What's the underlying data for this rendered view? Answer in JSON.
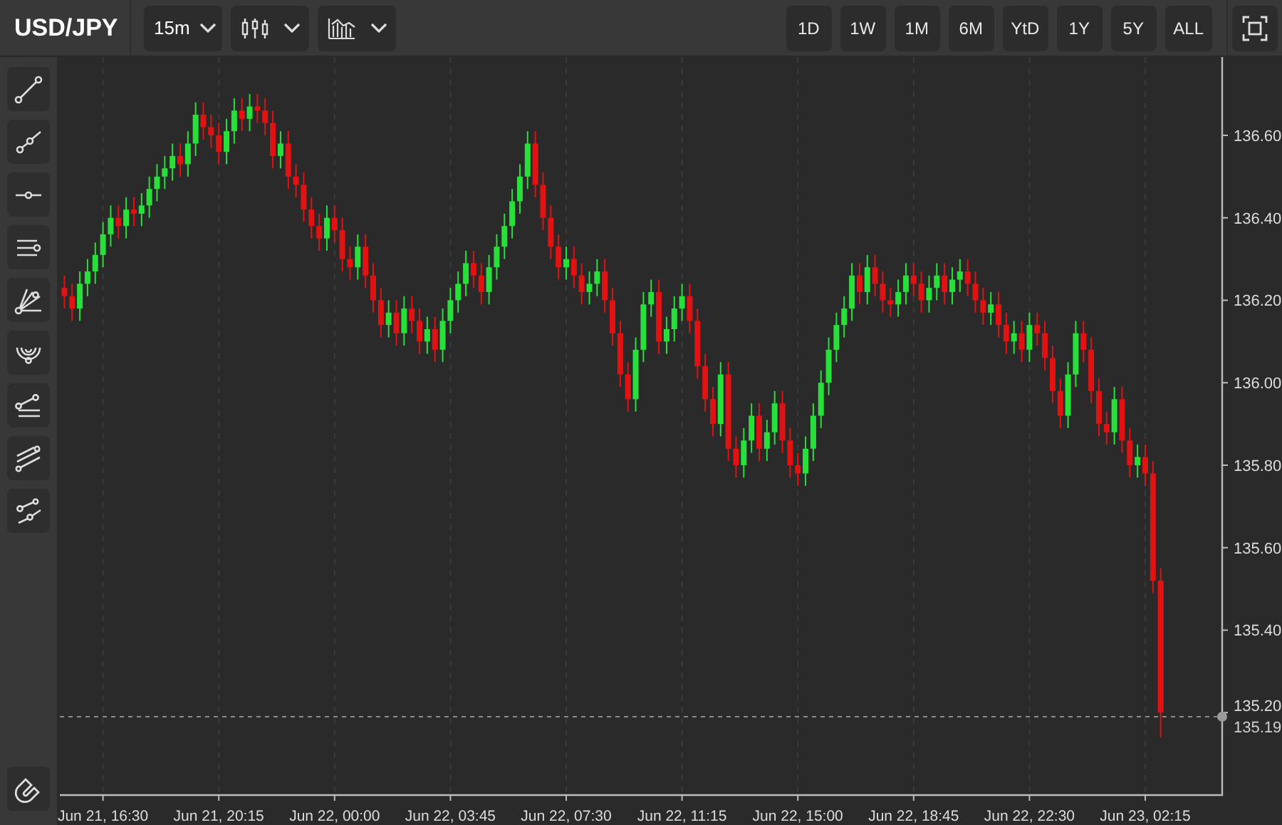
{
  "toolbar": {
    "symbol": "USD/JPY",
    "interval": "15m",
    "ranges": [
      {
        "label": "1D",
        "selected": false
      },
      {
        "label": "1W",
        "selected": false
      },
      {
        "label": "1M",
        "selected": false
      },
      {
        "label": "6M",
        "selected": false
      },
      {
        "label": "YtD",
        "selected": false
      },
      {
        "label": "1Y",
        "selected": false
      },
      {
        "label": "5Y",
        "selected": false
      },
      {
        "label": "ALL",
        "selected": false
      }
    ]
  },
  "chart": {
    "chart_data": {
      "type": "candlestick",
      "ylim": [
        135.0,
        136.79
      ],
      "ref_lines": [
        {
          "axis": "y",
          "value": 135.19,
          "label": "135.19"
        }
      ],
      "yticks": [
        {
          "value": 136.6,
          "label": "136.60"
        },
        {
          "value": 136.4,
          "label": "136.40"
        },
        {
          "value": 136.2,
          "label": "136.20"
        },
        {
          "value": 136.0,
          "label": "136.00"
        },
        {
          "value": 135.8,
          "label": "135.80"
        },
        {
          "value": 135.6,
          "label": "135.60"
        },
        {
          "value": 135.4,
          "label": "135.40"
        },
        {
          "value": 135.2,
          "label": "135.20"
        }
      ],
      "categories": [
        null,
        null,
        null,
        null,
        null,
        "Jun 21, 16:30",
        null,
        null,
        null,
        null,
        null,
        null,
        null,
        null,
        null,
        null,
        null,
        null,
        null,
        null,
        "Jun 21, 20:15",
        null,
        null,
        null,
        null,
        null,
        null,
        null,
        null,
        null,
        null,
        null,
        null,
        null,
        null,
        "Jun 22, 00:00",
        null,
        null,
        null,
        null,
        null,
        null,
        null,
        null,
        null,
        null,
        null,
        null,
        null,
        null,
        "Jun 22, 03:45",
        null,
        null,
        null,
        null,
        null,
        null,
        null,
        null,
        null,
        null,
        null,
        null,
        null,
        null,
        "Jun 22, 07:30",
        null,
        null,
        null,
        null,
        null,
        null,
        null,
        null,
        null,
        null,
        null,
        null,
        null,
        null,
        "Jun 22, 11:15",
        null,
        null,
        null,
        null,
        null,
        null,
        null,
        null,
        null,
        null,
        null,
        null,
        null,
        null,
        "Jun 22, 15:00",
        null,
        null,
        null,
        null,
        null,
        null,
        null,
        null,
        null,
        null,
        null,
        null,
        null,
        null,
        "Jun 22, 18:45",
        null,
        null,
        null,
        null,
        null,
        null,
        null,
        null,
        null,
        null,
        null,
        null,
        null,
        null,
        "Jun 22, 22:30",
        null,
        null,
        null,
        null,
        null,
        null,
        null,
        null,
        null,
        null,
        null,
        null,
        null,
        null,
        "Jun 23, 02:15",
        null,
        null
      ],
      "ohlc": [
        [
          136.23,
          136.26,
          136.18,
          136.21
        ],
        [
          136.21,
          136.24,
          136.15,
          136.18
        ],
        [
          136.18,
          136.27,
          136.15,
          136.24
        ],
        [
          136.24,
          136.3,
          136.21,
          136.27
        ],
        [
          136.27,
          136.34,
          136.24,
          136.31
        ],
        [
          136.31,
          136.39,
          136.28,
          136.36
        ],
        [
          136.36,
          136.43,
          136.33,
          136.4
        ],
        [
          136.4,
          136.43,
          136.35,
          136.38
        ],
        [
          136.38,
          136.45,
          136.35,
          136.42
        ],
        [
          136.42,
          136.45,
          136.38,
          136.41
        ],
        [
          136.41,
          136.46,
          136.38,
          136.43
        ],
        [
          136.43,
          136.5,
          136.4,
          136.47
        ],
        [
          136.47,
          136.53,
          136.44,
          136.5
        ],
        [
          136.5,
          136.55,
          136.47,
          136.52
        ],
        [
          136.52,
          136.58,
          136.49,
          136.55
        ],
        [
          136.55,
          136.58,
          136.5,
          136.53
        ],
        [
          136.53,
          136.61,
          136.5,
          136.58
        ],
        [
          136.58,
          136.68,
          136.55,
          136.65
        ],
        [
          136.65,
          136.68,
          136.59,
          136.62
        ],
        [
          136.62,
          136.65,
          136.57,
          136.6
        ],
        [
          136.6,
          136.63,
          136.53,
          136.56
        ],
        [
          136.56,
          136.64,
          136.53,
          136.61
        ],
        [
          136.61,
          136.69,
          136.58,
          136.66
        ],
        [
          136.66,
          136.69,
          136.61,
          136.64
        ],
        [
          136.64,
          136.7,
          136.61,
          136.67
        ],
        [
          136.67,
          136.7,
          136.63,
          136.66
        ],
        [
          136.66,
          136.69,
          136.6,
          136.63
        ],
        [
          136.63,
          136.66,
          136.52,
          136.55
        ],
        [
          136.55,
          136.61,
          136.52,
          136.58
        ],
        [
          136.58,
          136.61,
          136.47,
          136.5
        ],
        [
          136.5,
          136.53,
          136.45,
          136.48
        ],
        [
          136.48,
          136.51,
          136.39,
          136.42
        ],
        [
          136.42,
          136.45,
          136.35,
          136.38
        ],
        [
          136.38,
          136.41,
          136.32,
          136.35
        ],
        [
          136.35,
          136.43,
          136.32,
          136.4
        ],
        [
          136.4,
          136.43,
          136.34,
          136.37
        ],
        [
          136.37,
          136.4,
          136.27,
          136.3
        ],
        [
          136.3,
          136.33,
          136.25,
          136.28
        ],
        [
          136.28,
          136.36,
          136.25,
          136.33
        ],
        [
          136.33,
          136.36,
          136.23,
          136.26
        ],
        [
          136.26,
          136.29,
          136.17,
          136.2
        ],
        [
          136.2,
          136.23,
          136.11,
          136.14
        ],
        [
          136.14,
          136.2,
          136.11,
          136.17
        ],
        [
          136.17,
          136.2,
          136.09,
          136.12
        ],
        [
          136.12,
          136.21,
          136.09,
          136.18
        ],
        [
          136.18,
          136.21,
          136.12,
          136.15
        ],
        [
          136.15,
          136.18,
          136.07,
          136.1
        ],
        [
          136.1,
          136.16,
          136.07,
          136.13
        ],
        [
          136.13,
          136.16,
          136.05,
          136.08
        ],
        [
          136.08,
          136.18,
          136.05,
          136.15
        ],
        [
          136.15,
          136.23,
          136.12,
          136.2
        ],
        [
          136.2,
          136.27,
          136.17,
          136.24
        ],
        [
          136.24,
          136.32,
          136.21,
          136.29
        ],
        [
          136.29,
          136.32,
          136.23,
          136.26
        ],
        [
          136.26,
          136.29,
          136.19,
          136.22
        ],
        [
          136.22,
          136.31,
          136.19,
          136.28
        ],
        [
          136.28,
          136.36,
          136.25,
          136.33
        ],
        [
          136.33,
          136.41,
          136.3,
          136.38
        ],
        [
          136.38,
          136.47,
          136.35,
          136.44
        ],
        [
          136.44,
          136.53,
          136.41,
          136.5
        ],
        [
          136.5,
          136.61,
          136.47,
          136.58
        ],
        [
          136.58,
          136.61,
          136.45,
          136.48
        ],
        [
          136.48,
          136.51,
          136.37,
          136.4
        ],
        [
          136.4,
          136.43,
          136.3,
          136.33
        ],
        [
          136.33,
          136.36,
          136.25,
          136.28
        ],
        [
          136.28,
          136.33,
          136.25,
          136.3
        ],
        [
          136.3,
          136.33,
          136.23,
          136.26
        ],
        [
          136.26,
          136.29,
          136.19,
          136.22
        ],
        [
          136.22,
          136.27,
          136.19,
          136.24
        ],
        [
          136.24,
          136.3,
          136.21,
          136.27
        ],
        [
          136.27,
          136.3,
          136.17,
          136.2
        ],
        [
          136.2,
          136.23,
          136.09,
          136.12
        ],
        [
          136.12,
          136.15,
          135.99,
          136.02
        ],
        [
          136.02,
          136.05,
          135.93,
          135.96
        ],
        [
          135.96,
          136.11,
          135.93,
          136.08
        ],
        [
          136.08,
          136.22,
          136.05,
          136.19
        ],
        [
          136.19,
          136.25,
          136.16,
          136.22
        ],
        [
          136.22,
          136.25,
          136.07,
          136.1
        ],
        [
          136.1,
          136.16,
          136.07,
          136.13
        ],
        [
          136.13,
          136.21,
          136.1,
          136.18
        ],
        [
          136.18,
          136.24,
          136.15,
          136.21
        ],
        [
          136.21,
          136.24,
          136.12,
          136.15
        ],
        [
          136.15,
          136.18,
          136.01,
          136.04
        ],
        [
          136.04,
          136.07,
          135.93,
          135.96
        ],
        [
          135.96,
          135.99,
          135.87,
          135.9
        ],
        [
          135.9,
          136.05,
          135.87,
          136.02
        ],
        [
          136.02,
          136.05,
          135.81,
          135.84
        ],
        [
          135.84,
          135.87,
          135.77,
          135.8
        ],
        [
          135.8,
          135.89,
          135.77,
          135.86
        ],
        [
          135.86,
          135.95,
          135.83,
          135.92
        ],
        [
          135.92,
          135.95,
          135.81,
          135.84
        ],
        [
          135.84,
          135.91,
          135.81,
          135.88
        ],
        [
          135.88,
          135.98,
          135.85,
          135.95
        ],
        [
          135.95,
          135.98,
          135.83,
          135.86
        ],
        [
          135.86,
          135.89,
          135.77,
          135.8
        ],
        [
          135.8,
          135.83,
          135.75,
          135.78
        ],
        [
          135.78,
          135.87,
          135.75,
          135.84
        ],
        [
          135.84,
          135.95,
          135.81,
          135.92
        ],
        [
          135.92,
          136.03,
          135.89,
          136.0
        ],
        [
          136.0,
          136.11,
          135.97,
          136.08
        ],
        [
          136.08,
          136.17,
          136.05,
          136.14
        ],
        [
          136.14,
          136.21,
          136.11,
          136.18
        ],
        [
          136.18,
          136.29,
          136.15,
          136.26
        ],
        [
          136.26,
          136.29,
          136.19,
          136.22
        ],
        [
          136.22,
          136.31,
          136.19,
          136.28
        ],
        [
          136.28,
          136.31,
          136.21,
          136.24
        ],
        [
          136.24,
          136.27,
          136.17,
          136.2
        ],
        [
          136.2,
          136.23,
          136.16,
          136.19
        ],
        [
          136.19,
          136.25,
          136.16,
          136.22
        ],
        [
          136.22,
          136.29,
          136.19,
          136.26
        ],
        [
          136.26,
          136.29,
          136.21,
          136.24
        ],
        [
          136.24,
          136.27,
          136.17,
          136.2
        ],
        [
          136.2,
          136.26,
          136.17,
          136.23
        ],
        [
          136.23,
          136.29,
          136.2,
          136.26
        ],
        [
          136.26,
          136.29,
          136.19,
          136.22
        ],
        [
          136.22,
          136.28,
          136.19,
          136.25
        ],
        [
          136.25,
          136.3,
          136.22,
          136.27
        ],
        [
          136.27,
          136.3,
          136.21,
          136.24
        ],
        [
          136.24,
          136.27,
          136.17,
          136.2
        ],
        [
          136.2,
          136.23,
          136.14,
          136.17
        ],
        [
          136.17,
          136.22,
          136.14,
          136.19
        ],
        [
          136.19,
          136.22,
          136.11,
          136.14
        ],
        [
          136.14,
          136.17,
          136.07,
          136.1
        ],
        [
          136.1,
          136.15,
          136.07,
          136.12
        ],
        [
          136.12,
          136.15,
          136.05,
          136.08
        ],
        [
          136.08,
          136.17,
          136.05,
          136.14
        ],
        [
          136.14,
          136.17,
          136.09,
          136.12
        ],
        [
          136.12,
          136.15,
          136.03,
          136.06
        ],
        [
          136.06,
          136.09,
          135.95,
          135.98
        ],
        [
          135.98,
          136.01,
          135.89,
          135.92
        ],
        [
          135.92,
          136.05,
          135.89,
          136.02
        ],
        [
          136.02,
          136.15,
          135.99,
          136.12
        ],
        [
          136.12,
          136.15,
          136.05,
          136.08
        ],
        [
          136.08,
          136.11,
          135.95,
          135.98
        ],
        [
          135.98,
          136.01,
          135.87,
          135.9
        ],
        [
          135.9,
          135.93,
          135.85,
          135.88
        ],
        [
          135.88,
          135.99,
          135.85,
          135.96
        ],
        [
          135.96,
          135.99,
          135.83,
          135.86
        ],
        [
          135.86,
          135.89,
          135.77,
          135.8
        ],
        [
          135.8,
          135.85,
          135.77,
          135.82
        ],
        [
          135.82,
          135.85,
          135.75,
          135.78
        ],
        [
          135.78,
          135.81,
          135.49,
          135.52
        ],
        [
          135.52,
          135.55,
          135.14,
          135.2
        ]
      ]
    }
  }
}
